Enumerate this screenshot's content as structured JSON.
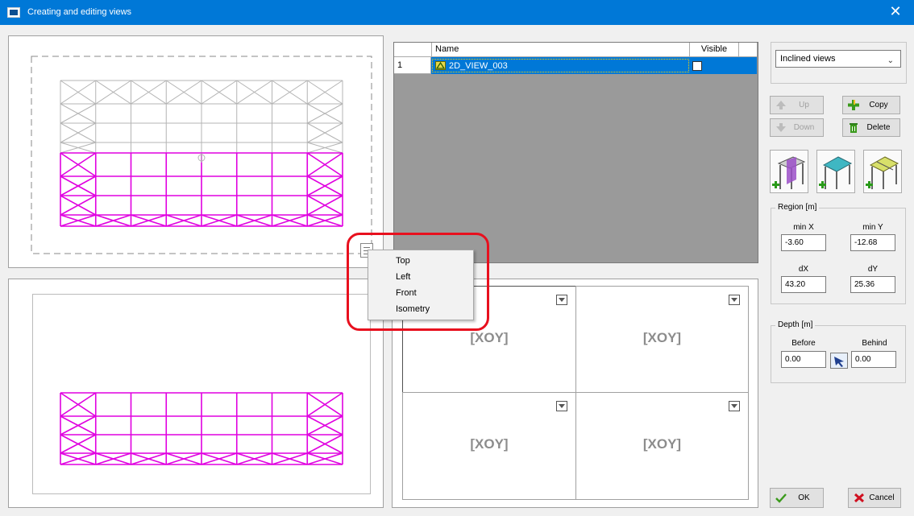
{
  "window": {
    "title": "Creating and editing views",
    "close_glyph": "✕"
  },
  "grid": {
    "headers": {
      "number": "",
      "name": "Name",
      "visible": "Visible"
    },
    "rows": [
      {
        "number": "1",
        "name": "2D_VIEW_003",
        "visible": false
      }
    ]
  },
  "layout": {
    "cells": [
      {
        "label": "[XOY]",
        "selected": true
      },
      {
        "label": "[XOY]",
        "selected": false
      },
      {
        "label": "[XOY]",
        "selected": false
      },
      {
        "label": "[XOY]",
        "selected": false
      }
    ]
  },
  "context_menu": {
    "items": [
      "Top",
      "Left",
      "Front",
      "Isometry"
    ]
  },
  "right_panel": {
    "view_type": "Inclined views",
    "buttons": {
      "up": "Up",
      "down": "Down",
      "copy": "Copy",
      "delete": "Delete",
      "ok": "OK",
      "cancel": "Cancel"
    },
    "region": {
      "title": "Region [m]",
      "min_x_label": "min X",
      "min_x": "-3.60",
      "min_y_label": "min Y",
      "min_y": "-12.68",
      "dx_label": "dX",
      "dx": "43.20",
      "dy_label": "dY",
      "dy": "25.36"
    },
    "depth": {
      "title": "Depth [m]",
      "before_label": "Before",
      "before": "0.00",
      "behind_label": "Behind",
      "behind": "0.00"
    }
  },
  "colors": {
    "accent": "#0078d7",
    "structure": "#e000e0",
    "highlight": "#e8101e"
  },
  "icons": {
    "app": "app-icon",
    "options": "view-options-icon",
    "pick": "pick-arrow-icon"
  }
}
